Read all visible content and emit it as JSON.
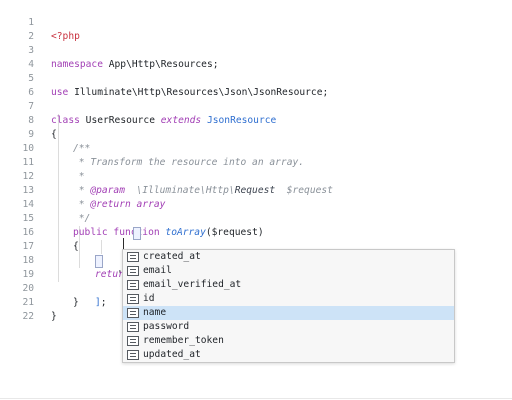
{
  "editor": {
    "line_numbers": [
      "1",
      "2",
      "3",
      "4",
      "5",
      "6",
      "7",
      "8",
      "9",
      "10",
      "11",
      "12",
      "13",
      "14",
      "15",
      "16",
      "17",
      "18",
      "19",
      "20",
      "21",
      "22"
    ],
    "tokens": {
      "php_open": "<?php",
      "namespace_kw": "namespace",
      "namespace_name": " App\\Http\\Resources;",
      "use_kw": "use",
      "use_path": " Illuminate\\Http\\Resources\\Json\\JsonResource;",
      "class_kw": "class",
      "class_name": " UserResource ",
      "extends_kw": "extends",
      "parent_class": " JsonResource",
      "open_brace": "{",
      "doc_open": "/**",
      "doc_line_transform": " * Transform the resource into an array.",
      "doc_star": " *",
      "doc_star_prefix": " * ",
      "param_tag": "@param",
      "param_ns": "  \\Illuminate\\Http\\",
      "param_type": "Request",
      "param_var": "  $request",
      "return_tag": "@return",
      "return_type": " array",
      "doc_close": " */",
      "public_kw": "public",
      "function_kw": " function ",
      "method_name": "toArray",
      "method_args": "($request)",
      "method_open": "{",
      "return_kw": "return",
      "array_open": "[",
      "typed_quote": "'",
      "typed_quote2": "'",
      "array_close": "]",
      "semicolon": ";",
      "method_close": "}",
      "class_close": "}"
    }
  },
  "autocomplete": {
    "items": [
      "created_at",
      "email",
      "email_verified_at",
      "id",
      "name",
      "password",
      "remember_token",
      "updated_at"
    ],
    "selected": "name",
    "icon": "field-icon"
  },
  "colors": {
    "keyword": "#a23fb5",
    "class_name": "#2f6fd0",
    "comment": "#8a9199",
    "selection": "#cde3f7"
  }
}
